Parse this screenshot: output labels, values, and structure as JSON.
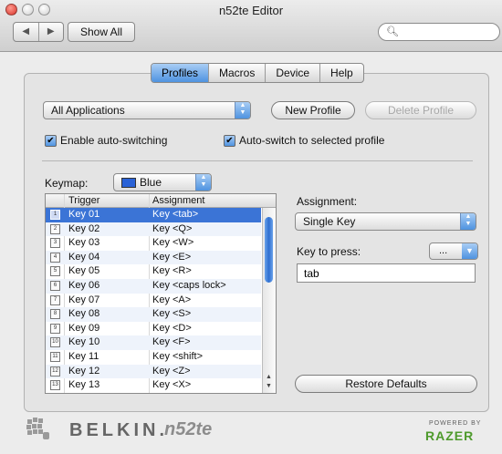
{
  "window": {
    "title": "n52te Editor"
  },
  "toolbar": {
    "back_label": "◀",
    "forward_label": "▶",
    "show_all": "Show All",
    "search": {
      "value": "",
      "placeholder": ""
    }
  },
  "tabs": [
    {
      "label": "Profiles",
      "active": true
    },
    {
      "label": "Macros",
      "active": false
    },
    {
      "label": "Device",
      "active": false
    },
    {
      "label": "Help",
      "active": false
    }
  ],
  "profile": {
    "application": "All Applications",
    "new_profile": "New Profile",
    "delete_profile": "Delete Profile",
    "enable_auto_switching": {
      "label": "Enable auto-switching",
      "checked": true
    },
    "auto_switch_selected": {
      "label": "Auto-switch to selected profile",
      "checked": true
    }
  },
  "keymap": {
    "label": "Keymap:",
    "value": "Blue",
    "swatch_color": "#2a62d6"
  },
  "table": {
    "headers": {
      "trigger": "Trigger",
      "assignment": "Assignment"
    },
    "rows": [
      {
        "icon": "1",
        "trigger": "Key 01",
        "assignment": "Key <tab>",
        "selected": true
      },
      {
        "icon": "2",
        "trigger": "Key 02",
        "assignment": "Key <Q>"
      },
      {
        "icon": "3",
        "trigger": "Key 03",
        "assignment": "Key <W>"
      },
      {
        "icon": "4",
        "trigger": "Key 04",
        "assignment": "Key <E>"
      },
      {
        "icon": "5",
        "trigger": "Key 05",
        "assignment": "Key <R>"
      },
      {
        "icon": "6",
        "trigger": "Key 06",
        "assignment": "Key <caps lock>"
      },
      {
        "icon": "7",
        "trigger": "Key 07",
        "assignment": "Key <A>"
      },
      {
        "icon": "8",
        "trigger": "Key 08",
        "assignment": "Key <S>"
      },
      {
        "icon": "9",
        "trigger": "Key 09",
        "assignment": "Key <D>"
      },
      {
        "icon": "10",
        "trigger": "Key 10",
        "assignment": "Key <F>"
      },
      {
        "icon": "11",
        "trigger": "Key 11",
        "assignment": "Key <shift>"
      },
      {
        "icon": "12",
        "trigger": "Key 12",
        "assignment": "Key <Z>"
      },
      {
        "icon": "13",
        "trigger": "Key 13",
        "assignment": "Key <X>"
      }
    ]
  },
  "assignment": {
    "label": "Assignment:",
    "type": "Single Key",
    "key_to_press_label": "Key to press:",
    "key_menu": "...",
    "key_value": "tab",
    "restore_defaults": "Restore Defaults"
  },
  "footer": {
    "brand": "BELKIN",
    "brand_mark": ".",
    "model": "n52te",
    "powered_by": "POWERED BY",
    "razer": "RAZER"
  },
  "colors": {
    "accent": "#4f93e0",
    "selection": "#3b74d6",
    "razer_green": "#4e9a2c"
  }
}
